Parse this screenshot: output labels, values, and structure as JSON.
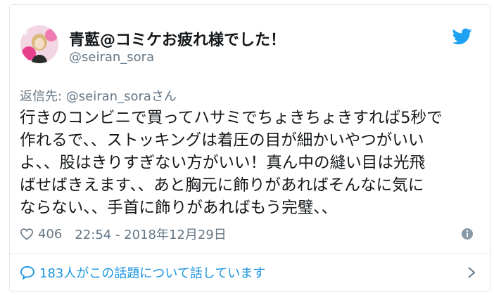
{
  "user": {
    "display_name": "青藍@コミケお疲れ様でした！",
    "handle": "@seiran_sora"
  },
  "reply_context": {
    "prefix": "返信先: ",
    "mention": "@seiran_sora",
    "suffix": "さん"
  },
  "tweet": {
    "lines": [
      "行きのコンビニで買ってハサミでちょきちょきすれば5秒で",
      "作れるで、、ストッキングは着圧の目が細かいやつがいい",
      "よ、、股はきりすぎない方がいい！真ん中の縫い目は光飛",
      "ばせばきえます、、あと胸元に飾りがあればそんなに気に",
      "ならない、、手首に飾りがあればもう完璧、、"
    ]
  },
  "meta": {
    "like_count": "406",
    "timestamp": "22:54 - 2018年12月29日"
  },
  "conversation": {
    "label": "183人がこの話題について話しています"
  },
  "icons": {
    "brand": "twitter-bird-icon",
    "like": "heart-icon",
    "info": "info-icon",
    "conversation": "speech-bubble-icon",
    "chevron": "chevron-right-icon"
  },
  "colors": {
    "twitter_blue": "#1da1f2",
    "link_blue": "#1b95e0",
    "secondary_text": "#657786",
    "primary_text": "#14171a"
  }
}
